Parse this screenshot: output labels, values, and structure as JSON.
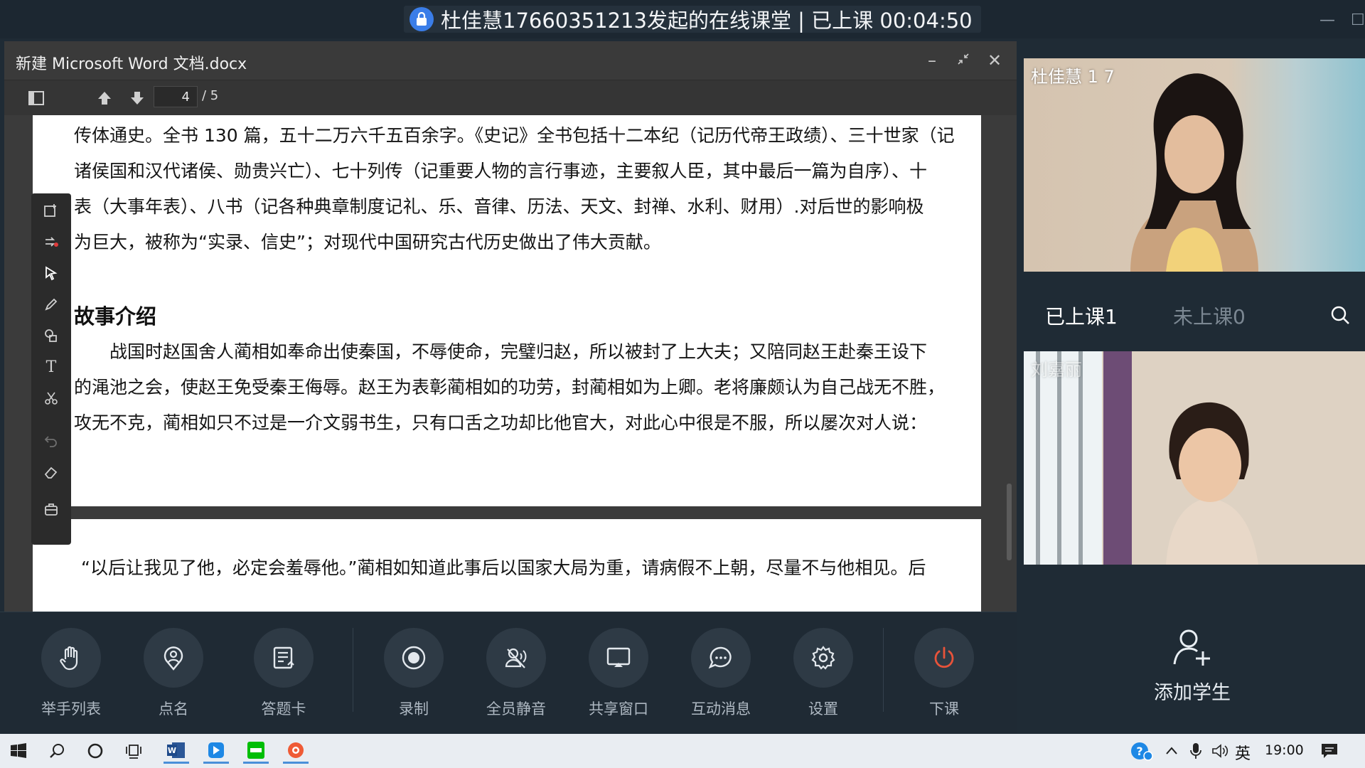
{
  "window": {
    "title": "杜佳慧17660351213发起的在线课堂 | 已上课 00:04:50"
  },
  "document": {
    "filename": "新建 Microsoft Word 文档.docx",
    "page_current": "4",
    "page_total": "/ 5",
    "page1_paragraphs": [
      "传体通史。全书 130 篇，五十二万六千五百余字。《史记》全书包括十二本纪（记历代帝王政绩）、三十世家（记",
      "诸侯国和汉代诸侯、勋贵兴亡）、七十列传（记重要人物的言行事迹，主要叙人臣，其中最后一篇为自序）、十",
      "表（大事年表）、八书（记各种典章制度记礼、乐、音律、历法、天文、封禅、水利、财用）.对后世的影响极",
      "为巨大，被称为“实录、信史”；对现代中国研究古代历史做出了伟大贡献。"
    ],
    "heading": "故事介绍",
    "story_paragraphs": [
      "　　战国时赵国舍人蔺相如奉命出使秦国，不辱使命，完璧归赵，所以被封了上大夫；又陪同赵王赴秦王设下",
      "的渑池之会，使赵王免受秦王侮辱。赵王为表彰蔺相如的功劳，封蔺相如为上卿。老将廉颇认为自己战无不胜，",
      "攻无不克，蔺相如只不过是一介文弱书生，只有口舌之功却比他官大，对此心中很是不服，所以屡次对人说："
    ],
    "page2_paragraph": "“以后让我见了他，必定会羞辱他。”蔺相如知道此事后以国家大局为重，请病假不上朝，尽量不与他相见。后"
  },
  "controls": [
    {
      "label": "举手列表",
      "icon": "hand-icon"
    },
    {
      "label": "点名",
      "icon": "roll-call-icon"
    },
    {
      "label": "答题卡",
      "icon": "answer-card-icon"
    },
    {
      "label": "录制",
      "icon": "record-icon"
    },
    {
      "label": "全员静音",
      "icon": "mute-all-icon"
    },
    {
      "label": "共享窗口",
      "icon": "share-window-icon"
    },
    {
      "label": "互动消息",
      "icon": "chat-icon"
    },
    {
      "label": "设置",
      "icon": "gear-icon"
    },
    {
      "label": "下课",
      "icon": "power-icon"
    }
  ],
  "sidebar": {
    "teacher_name": "杜佳慧 1 7",
    "student_name": "刘嘉丽",
    "tab_joined": "已上课1",
    "tab_not_joined": "未上课0",
    "add_student_label": "添加学生"
  },
  "taskbar": {
    "ime": "英",
    "time": "19:00"
  },
  "colors": {
    "accent": "#3a7de8",
    "end_class": "#e8533a",
    "panel_bg": "#1f2b35"
  }
}
